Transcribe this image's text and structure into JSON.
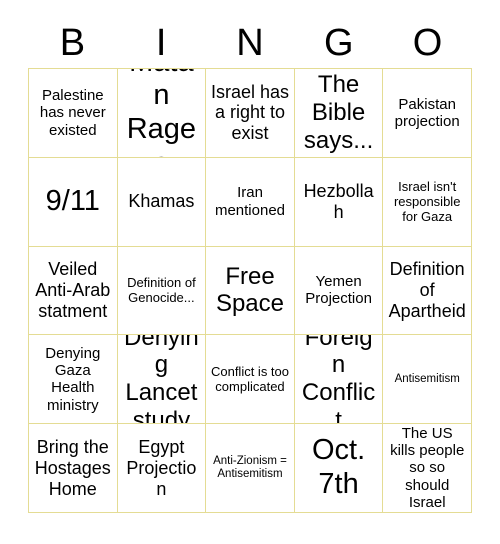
{
  "card": {
    "title_letters": [
      "B",
      "I",
      "N",
      "G",
      "O"
    ],
    "border_color": "#e4dc94",
    "background_color": "#ffffff",
    "text_color": "#000000",
    "columns": 5,
    "rows": 5,
    "free_space_index": 12,
    "cells": [
      {
        "text": "Palestine has never existed",
        "size": "fs-sm"
      },
      {
        "text": "Matan Rages",
        "size": "fs-xl"
      },
      {
        "text": "Israel has a right to exist",
        "size": "fs-md"
      },
      {
        "text": "The Bible says...",
        "size": "fs-lg"
      },
      {
        "text": "Pakistan projection",
        "size": "fs-sm"
      },
      {
        "text": "9/11",
        "size": "fs-xl"
      },
      {
        "text": "Khamas",
        "size": "fs-md"
      },
      {
        "text": "Iran mentioned",
        "size": "fs-sm"
      },
      {
        "text": "Hezbollah",
        "size": "fs-md"
      },
      {
        "text": "Israel isn't responsible for Gaza",
        "size": "fs-xs"
      },
      {
        "text": "Veiled Anti-Arab statment",
        "size": "fs-md"
      },
      {
        "text": "Definition of Genocide...",
        "size": "fs-xs"
      },
      {
        "text": "Free Space",
        "size": "fs-lg"
      },
      {
        "text": "Yemen Projection",
        "size": "fs-sm"
      },
      {
        "text": "Definition of Apartheid",
        "size": "fs-md"
      },
      {
        "text": "Denying Gaza Health ministry",
        "size": "fs-sm"
      },
      {
        "text": "Denying Lancet study",
        "size": "fs-lg"
      },
      {
        "text": "Conflict is too complicated",
        "size": "fs-xs"
      },
      {
        "text": "Foreign Conflict",
        "size": "fs-lg"
      },
      {
        "text": "Antisemitism",
        "size": "fs-xxs"
      },
      {
        "text": "Bring the Hostages Home",
        "size": "fs-md"
      },
      {
        "text": "Egypt Projection",
        "size": "fs-md"
      },
      {
        "text": "Anti-Zionism = Antisemitism",
        "size": "fs-xxs"
      },
      {
        "text": "Oct. 7th",
        "size": "fs-xl"
      },
      {
        "text": "The US kills people so so should Israel",
        "size": "fs-sm"
      }
    ]
  }
}
